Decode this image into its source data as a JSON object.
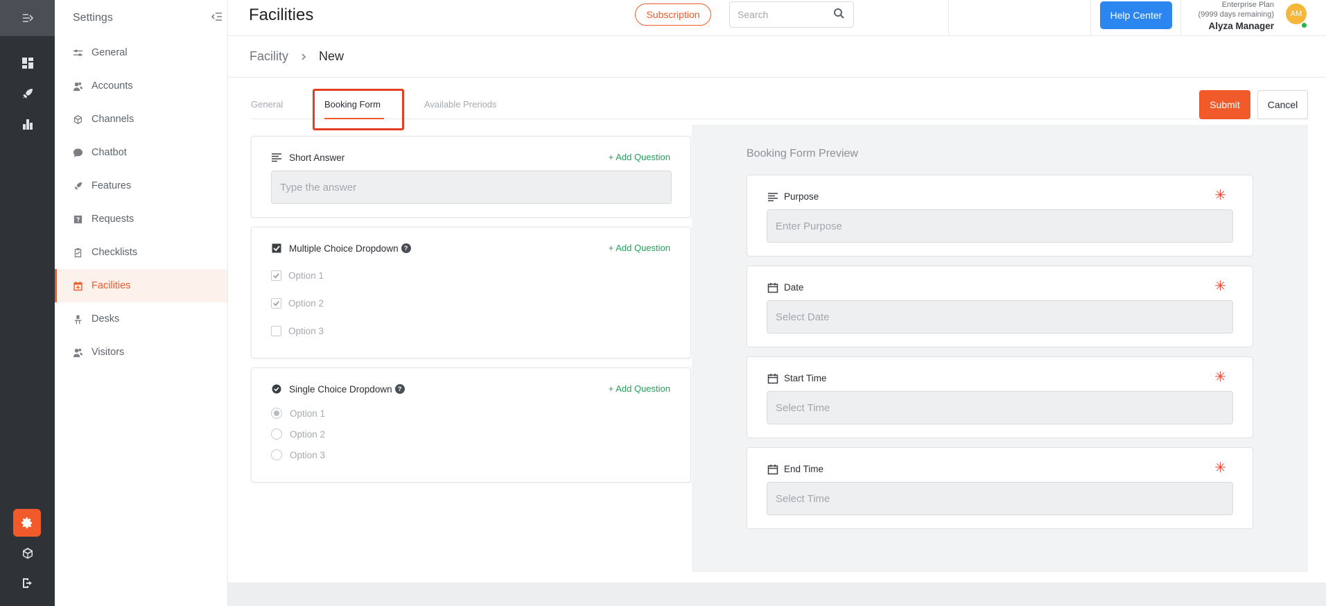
{
  "colors": {
    "accent": "#f15a2b",
    "rail_bg": "#2f3338",
    "help_blue": "#2b86f0",
    "add_green": "#22a05b",
    "required_red": "#f0432f"
  },
  "rail": {
    "icons": [
      "expand-icon",
      "dashboard-icon",
      "rocket-icon",
      "analytics-icon",
      "settings-icon",
      "cube-icon",
      "logout-icon"
    ]
  },
  "sidebar": {
    "title": "Settings",
    "items": [
      {
        "label": "General",
        "icon": "sliders-icon"
      },
      {
        "label": "Accounts",
        "icon": "users-icon"
      },
      {
        "label": "Channels",
        "icon": "cube-icon"
      },
      {
        "label": "Chatbot",
        "icon": "chat-icon"
      },
      {
        "label": "Features",
        "icon": "rocket-icon"
      },
      {
        "label": "Requests",
        "icon": "question-square-icon"
      },
      {
        "label": "Checklists",
        "icon": "checklist-icon"
      },
      {
        "label": "Facilities",
        "icon": "calendar-plus-icon",
        "active": true
      },
      {
        "label": "Desks",
        "icon": "desk-icon"
      },
      {
        "label": "Visitors",
        "icon": "users-icon"
      }
    ]
  },
  "header": {
    "title": "Facilities",
    "subscription_label": "Subscription",
    "search_placeholder": "Search",
    "help_label": "Help Center",
    "plan_line1": "Enterprise Plan",
    "plan_line2": "(9999 days remaining)",
    "user_name": "Alyza Manager",
    "avatar_initials": "AM"
  },
  "breadcrumb": {
    "parent": "Facility",
    "current": "New"
  },
  "tabs": [
    {
      "label": "General"
    },
    {
      "label": "Booking Form",
      "active": true
    },
    {
      "label": "Available Preriods"
    }
  ],
  "actions": {
    "submit_label": "Submit",
    "cancel_label": "Cancel"
  },
  "questions": {
    "add_label": "+ Add Question",
    "short_answer": {
      "title": "Short Answer",
      "placeholder": "Type the answer"
    },
    "multiple_choice": {
      "title": "Multiple Choice Dropdown",
      "options": [
        {
          "label": "Option 1",
          "checked": true
        },
        {
          "label": "Option 2",
          "checked": true
        },
        {
          "label": "Option 3",
          "checked": false
        }
      ]
    },
    "single_choice": {
      "title": "Single Choice Dropdown",
      "options": [
        {
          "label": "Option 1",
          "selected": true
        },
        {
          "label": "Option 2",
          "selected": false
        },
        {
          "label": "Option 3",
          "selected": false
        }
      ]
    }
  },
  "preview": {
    "title": "Booking Form Preview",
    "required_mark": "✳",
    "fields": [
      {
        "label": "Purpose",
        "placeholder": "Enter Purpose",
        "icon": "text-lines-icon"
      },
      {
        "label": "Date",
        "placeholder": "Select Date",
        "icon": "calendar-icon"
      },
      {
        "label": "Start Time",
        "placeholder": "Select Time",
        "icon": "calendar-icon"
      },
      {
        "label": "End Time",
        "placeholder": "Select Time",
        "icon": "calendar-icon"
      }
    ]
  }
}
